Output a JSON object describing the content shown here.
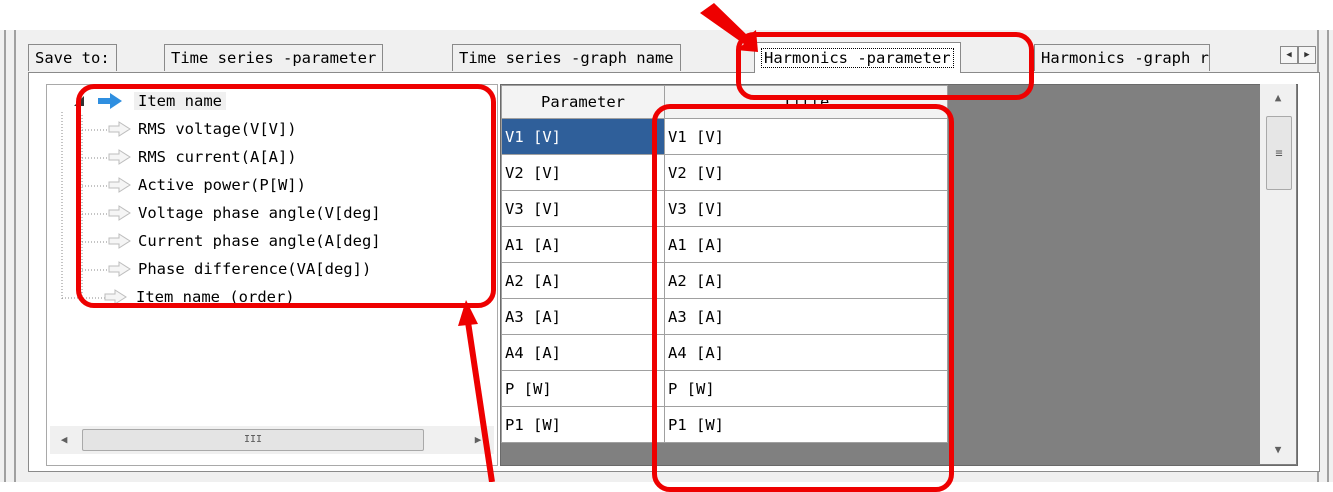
{
  "tabs": [
    {
      "label": "Save to:"
    },
    {
      "label": "Time series -parameter"
    },
    {
      "label": "Time series -graph name"
    },
    {
      "label": "Harmonics -parameter",
      "active": true
    },
    {
      "label": "Harmonics -graph r"
    }
  ],
  "tree": {
    "root_label": "Item name",
    "children": [
      "RMS voltage(V[V])",
      "RMS current(A[A])",
      "Active power(P[W])",
      "Voltage phase angle(V[deg]",
      "Current phase angle(A[deg]",
      "Phase difference(VA[deg])"
    ],
    "second_root_label": "Item name (order)",
    "hscroll_thumb_glyph": "III"
  },
  "grid": {
    "columns": [
      "Parameter",
      "Title"
    ],
    "rows": [
      {
        "parameter": "V1 [V]",
        "title": "V1 [V]",
        "selected": true
      },
      {
        "parameter": "V2 [V]",
        "title": "V2 [V]"
      },
      {
        "parameter": "V3 [V]",
        "title": "V3 [V]"
      },
      {
        "parameter": "A1 [A]",
        "title": "A1 [A]"
      },
      {
        "parameter": "A2 [A]",
        "title": "A2 [A]"
      },
      {
        "parameter": "A3 [A]",
        "title": "A3 [A]"
      },
      {
        "parameter": "A4 [A]",
        "title": "A4 [A]"
      },
      {
        "parameter": "P [W]",
        "title": "P [W]"
      },
      {
        "parameter": "P1 [W]",
        "title": "P1 [W]"
      }
    ],
    "vscroll_thumb_glyph": "≡"
  },
  "colors": {
    "annotation_red": "#ee0000",
    "selection_blue": "#2f5f9a",
    "arrow_blue": "#2f8fe0"
  }
}
